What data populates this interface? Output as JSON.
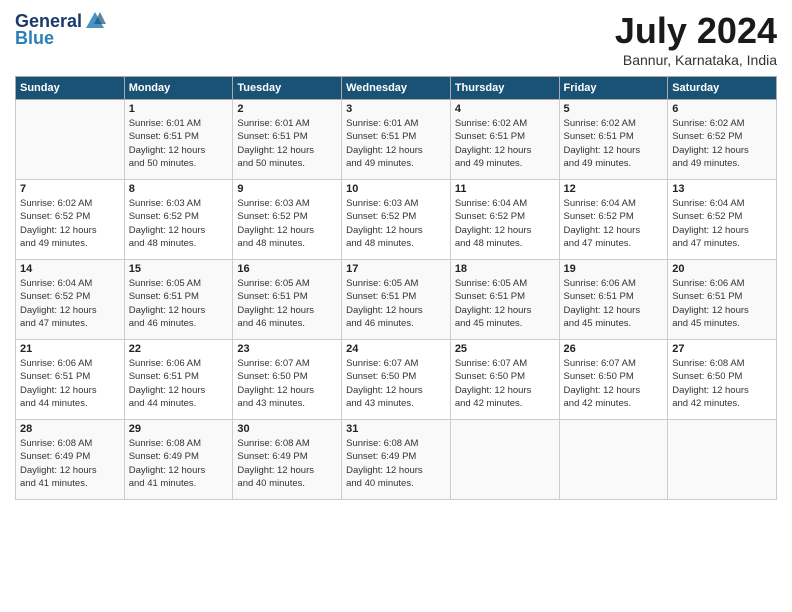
{
  "header": {
    "logo_line1": "General",
    "logo_line2": "Blue",
    "title": "July 2024",
    "location": "Bannur, Karnataka, India"
  },
  "weekdays": [
    "Sunday",
    "Monday",
    "Tuesday",
    "Wednesday",
    "Thursday",
    "Friday",
    "Saturday"
  ],
  "weeks": [
    [
      {
        "day": "",
        "info": ""
      },
      {
        "day": "1",
        "info": "Sunrise: 6:01 AM\nSunset: 6:51 PM\nDaylight: 12 hours\nand 50 minutes."
      },
      {
        "day": "2",
        "info": "Sunrise: 6:01 AM\nSunset: 6:51 PM\nDaylight: 12 hours\nand 50 minutes."
      },
      {
        "day": "3",
        "info": "Sunrise: 6:01 AM\nSunset: 6:51 PM\nDaylight: 12 hours\nand 49 minutes."
      },
      {
        "day": "4",
        "info": "Sunrise: 6:02 AM\nSunset: 6:51 PM\nDaylight: 12 hours\nand 49 minutes."
      },
      {
        "day": "5",
        "info": "Sunrise: 6:02 AM\nSunset: 6:51 PM\nDaylight: 12 hours\nand 49 minutes."
      },
      {
        "day": "6",
        "info": "Sunrise: 6:02 AM\nSunset: 6:52 PM\nDaylight: 12 hours\nand 49 minutes."
      }
    ],
    [
      {
        "day": "7",
        "info": "Sunrise: 6:02 AM\nSunset: 6:52 PM\nDaylight: 12 hours\nand 49 minutes."
      },
      {
        "day": "8",
        "info": "Sunrise: 6:03 AM\nSunset: 6:52 PM\nDaylight: 12 hours\nand 48 minutes."
      },
      {
        "day": "9",
        "info": "Sunrise: 6:03 AM\nSunset: 6:52 PM\nDaylight: 12 hours\nand 48 minutes."
      },
      {
        "day": "10",
        "info": "Sunrise: 6:03 AM\nSunset: 6:52 PM\nDaylight: 12 hours\nand 48 minutes."
      },
      {
        "day": "11",
        "info": "Sunrise: 6:04 AM\nSunset: 6:52 PM\nDaylight: 12 hours\nand 48 minutes."
      },
      {
        "day": "12",
        "info": "Sunrise: 6:04 AM\nSunset: 6:52 PM\nDaylight: 12 hours\nand 47 minutes."
      },
      {
        "day": "13",
        "info": "Sunrise: 6:04 AM\nSunset: 6:52 PM\nDaylight: 12 hours\nand 47 minutes."
      }
    ],
    [
      {
        "day": "14",
        "info": "Sunrise: 6:04 AM\nSunset: 6:52 PM\nDaylight: 12 hours\nand 47 minutes."
      },
      {
        "day": "15",
        "info": "Sunrise: 6:05 AM\nSunset: 6:51 PM\nDaylight: 12 hours\nand 46 minutes."
      },
      {
        "day": "16",
        "info": "Sunrise: 6:05 AM\nSunset: 6:51 PM\nDaylight: 12 hours\nand 46 minutes."
      },
      {
        "day": "17",
        "info": "Sunrise: 6:05 AM\nSunset: 6:51 PM\nDaylight: 12 hours\nand 46 minutes."
      },
      {
        "day": "18",
        "info": "Sunrise: 6:05 AM\nSunset: 6:51 PM\nDaylight: 12 hours\nand 45 minutes."
      },
      {
        "day": "19",
        "info": "Sunrise: 6:06 AM\nSunset: 6:51 PM\nDaylight: 12 hours\nand 45 minutes."
      },
      {
        "day": "20",
        "info": "Sunrise: 6:06 AM\nSunset: 6:51 PM\nDaylight: 12 hours\nand 45 minutes."
      }
    ],
    [
      {
        "day": "21",
        "info": "Sunrise: 6:06 AM\nSunset: 6:51 PM\nDaylight: 12 hours\nand 44 minutes."
      },
      {
        "day": "22",
        "info": "Sunrise: 6:06 AM\nSunset: 6:51 PM\nDaylight: 12 hours\nand 44 minutes."
      },
      {
        "day": "23",
        "info": "Sunrise: 6:07 AM\nSunset: 6:50 PM\nDaylight: 12 hours\nand 43 minutes."
      },
      {
        "day": "24",
        "info": "Sunrise: 6:07 AM\nSunset: 6:50 PM\nDaylight: 12 hours\nand 43 minutes."
      },
      {
        "day": "25",
        "info": "Sunrise: 6:07 AM\nSunset: 6:50 PM\nDaylight: 12 hours\nand 42 minutes."
      },
      {
        "day": "26",
        "info": "Sunrise: 6:07 AM\nSunset: 6:50 PM\nDaylight: 12 hours\nand 42 minutes."
      },
      {
        "day": "27",
        "info": "Sunrise: 6:08 AM\nSunset: 6:50 PM\nDaylight: 12 hours\nand 42 minutes."
      }
    ],
    [
      {
        "day": "28",
        "info": "Sunrise: 6:08 AM\nSunset: 6:49 PM\nDaylight: 12 hours\nand 41 minutes."
      },
      {
        "day": "29",
        "info": "Sunrise: 6:08 AM\nSunset: 6:49 PM\nDaylight: 12 hours\nand 41 minutes."
      },
      {
        "day": "30",
        "info": "Sunrise: 6:08 AM\nSunset: 6:49 PM\nDaylight: 12 hours\nand 40 minutes."
      },
      {
        "day": "31",
        "info": "Sunrise: 6:08 AM\nSunset: 6:49 PM\nDaylight: 12 hours\nand 40 minutes."
      },
      {
        "day": "",
        "info": ""
      },
      {
        "day": "",
        "info": ""
      },
      {
        "day": "",
        "info": ""
      }
    ]
  ]
}
